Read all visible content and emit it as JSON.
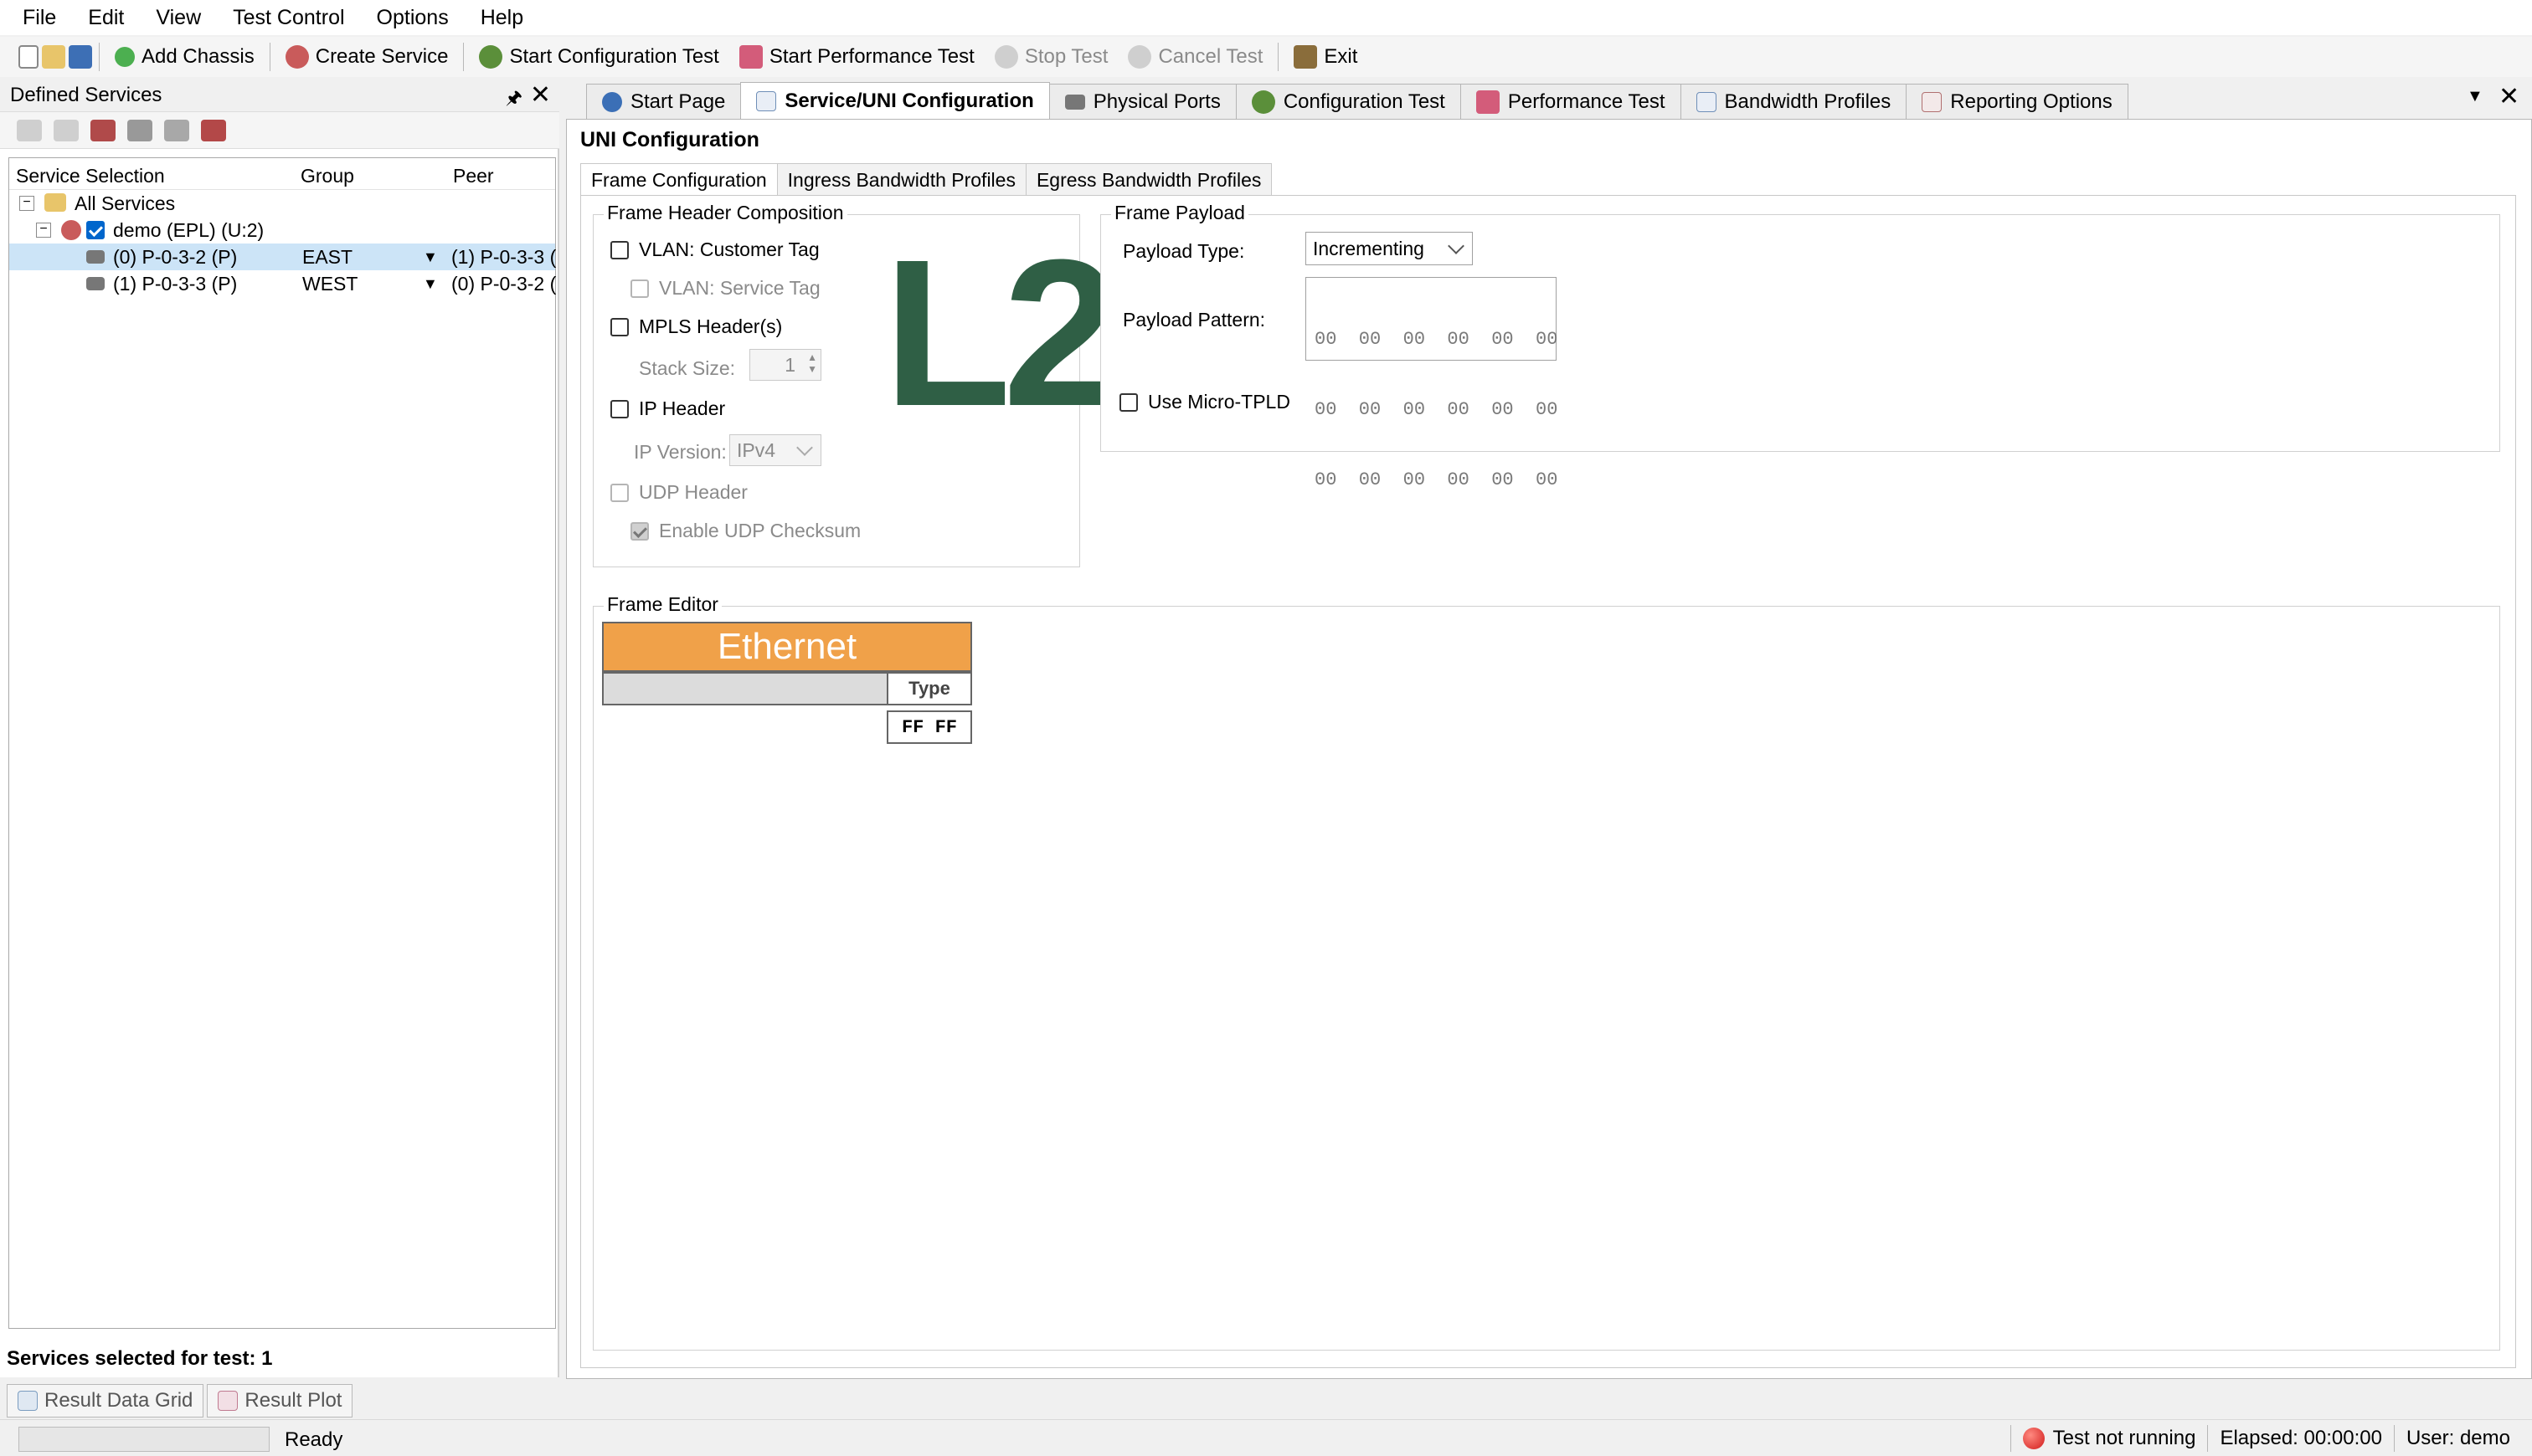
{
  "menu": [
    "File",
    "Edit",
    "View",
    "Test Control",
    "Options",
    "Help"
  ],
  "toolbar": {
    "add_chassis": "Add Chassis",
    "create_service": "Create Service",
    "start_config_test": "Start Configuration Test",
    "start_perf_test": "Start Performance Test",
    "stop_test": "Stop Test",
    "cancel_test": "Cancel Test",
    "exit": "Exit"
  },
  "left_panel": {
    "title": "Defined Services",
    "columns": [
      "Service Selection",
      "Group",
      "Peer"
    ],
    "root": "All Services",
    "service": "demo (EPL) (U:2)",
    "rows": [
      {
        "port": "(0) P-0-3-2 (P)",
        "group": "EAST",
        "peer": "(1) P-0-3-3 ("
      },
      {
        "port": "(1) P-0-3-3 (P)",
        "group": "WEST",
        "peer": "(0) P-0-3-2 ("
      }
    ],
    "footer": "Services selected for test:  1"
  },
  "bottom_tabs": [
    "Result Data Grid",
    "Result Plot"
  ],
  "status": {
    "ready": "Ready",
    "test_state": "Test not running",
    "elapsed": "Elapsed: 00:00:00",
    "user": "User: demo"
  },
  "doc_tabs": [
    "Start Page",
    "Service/UNI Configuration",
    "Physical Ports",
    "Configuration Test",
    "Performance Test",
    "Bandwidth Profiles",
    "Reporting Options"
  ],
  "uni": {
    "title": "UNI Configuration",
    "sub_tabs": [
      "Frame Configuration",
      "Ingress Bandwidth Profiles",
      "Egress Bandwidth Profiles"
    ],
    "header_group": {
      "label": "Frame Header Composition",
      "vlan_customer": "VLAN: Customer Tag",
      "vlan_service": "VLAN: Service Tag",
      "mpls": "MPLS Header(s)",
      "stack_size_label": "Stack Size:",
      "stack_size_value": "1",
      "ip_header": "IP Header",
      "ip_version_label": "IP Version:",
      "ip_version_value": "IPv4",
      "udp_header": "UDP Header",
      "udp_checksum": "Enable UDP Checksum",
      "logo": "L2"
    },
    "payload_group": {
      "label": "Frame Payload",
      "payload_type_label": "Payload Type:",
      "payload_type_value": "Incrementing",
      "payload_pattern_label": "Payload Pattern:",
      "pattern_lines": [
        "00  00  00  00  00  00",
        "00  00  00  00  00  00",
        "00  00  00  00  00  00"
      ],
      "micro_tpld": "Use Micro-TPLD"
    },
    "editor": {
      "label": "Frame Editor",
      "ethernet": "Ethernet",
      "type_label": "Type",
      "type_value": "FF FF"
    }
  },
  "colors": {
    "ethernet_orange": "#f0a149",
    "logo_green": "#2f5f45",
    "selection_blue": "#cce4f7"
  }
}
